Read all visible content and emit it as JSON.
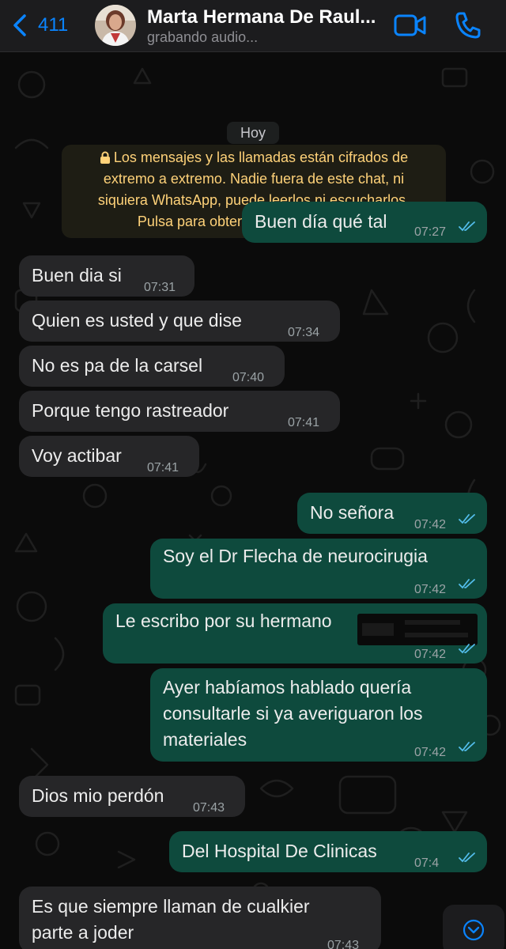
{
  "header": {
    "back_count": "411",
    "contact_name": "Marta Hermana De Raul...",
    "status": "grabando audio...",
    "icons": {
      "back": "chevron-left-icon",
      "video": "video-camera-icon",
      "call": "phone-icon"
    },
    "accent_color": "#0a84ff"
  },
  "chat": {
    "day_label": "Hoy",
    "encryption_notice": {
      "line1": "Los mensajes y las llamadas están cifrados de",
      "line2": "extremo a extremo. Nadie fuera de este chat, ni",
      "line3": "siquiera WhatsApp, puede leerlos ni escucharlos.",
      "line4": "Pulsa para obtener más información.",
      "text_color": "#ffd279"
    },
    "messages": [
      {
        "direction": "out",
        "lines": [
          "Buen día qué tal"
        ],
        "time": "07:27",
        "read": true
      },
      {
        "direction": "in",
        "lines": [
          "Buen dia si"
        ],
        "time": "07:31"
      },
      {
        "direction": "in",
        "lines": [
          "Quien es usted y que dise"
        ],
        "time": "07:34"
      },
      {
        "direction": "in",
        "lines": [
          "No es pa de la carsel"
        ],
        "time": "07:40"
      },
      {
        "direction": "in",
        "lines": [
          "Porque tengo rastreador"
        ],
        "time": "07:41"
      },
      {
        "direction": "in",
        "lines": [
          "Voy actibar"
        ],
        "time": "07:41"
      },
      {
        "direction": "out",
        "lines": [
          "No señora"
        ],
        "time": "07:42",
        "read": true
      },
      {
        "direction": "out",
        "lines": [
          "Soy el Dr Flecha de neurocirugia"
        ],
        "time": "07:42",
        "read": true
      },
      {
        "direction": "out",
        "lines": [
          "Le escribo por su hermano"
        ],
        "time": "07:42",
        "read": true,
        "redacted": true
      },
      {
        "direction": "out",
        "lines": [
          "Ayer habíamos hablado quería",
          "consultarle si ya averiguaron los",
          "materiales"
        ],
        "time": "07:42",
        "read": true
      },
      {
        "direction": "in",
        "lines": [
          "Dios mio perdón"
        ],
        "time": "07:43"
      },
      {
        "direction": "out",
        "lines": [
          "Del Hospital De Clinicas"
        ],
        "time": "07:4",
        "read": true
      },
      {
        "direction": "in",
        "lines": [
          "Es que siempre llaman de cualkier",
          "parte a joder"
        ],
        "time": "07:43"
      }
    ],
    "read_tick_color": "#53bdeb",
    "scroll_button_icon": "chevron-down-icon"
  }
}
